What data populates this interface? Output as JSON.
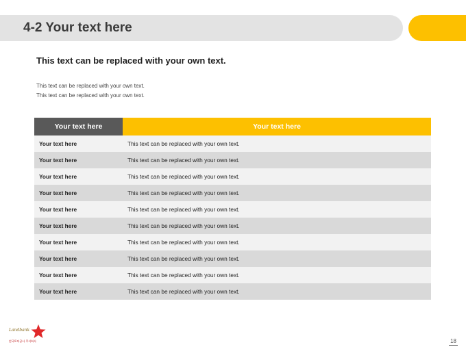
{
  "slide": {
    "title": "4-2 Your text here",
    "subtitle": "This text can be replaced with your own text.",
    "body_lines": [
      "This text can be replaced with your own text.",
      "This text can be replaced with your own text."
    ],
    "page_number": "18"
  },
  "table": {
    "headers": [
      "Your text here",
      "Your text here"
    ],
    "rows": [
      [
        "Your text here",
        "This text can be replaced with your own text."
      ],
      [
        "Your text here",
        "This text can be replaced with your own text."
      ],
      [
        "Your text here",
        "This text can be replaced with your own text."
      ],
      [
        "Your text here",
        "This text can be replaced with your own text."
      ],
      [
        "Your text here",
        "This text can be replaced with your own text."
      ],
      [
        "Your text here",
        "This text can be replaced with your own text."
      ],
      [
        "Your text here",
        "This text can be replaced with your own text."
      ],
      [
        "Your text here",
        "This text can be replaced with your own text."
      ],
      [
        "Your text here",
        "This text can be replaced with your own text."
      ],
      [
        "Your text here",
        "This text can be replaced with your own text."
      ]
    ]
  },
  "logo": {
    "script_text": "Landbank",
    "caption": "한국토지공사 주식회사"
  },
  "colors": {
    "accent": "#fdc000",
    "header_dark": "#595959",
    "title_bar": "#e3e3e3",
    "row_light": "#f2f2f2",
    "row_dark": "#d9d9d9",
    "logo_red": "#e0282a"
  }
}
